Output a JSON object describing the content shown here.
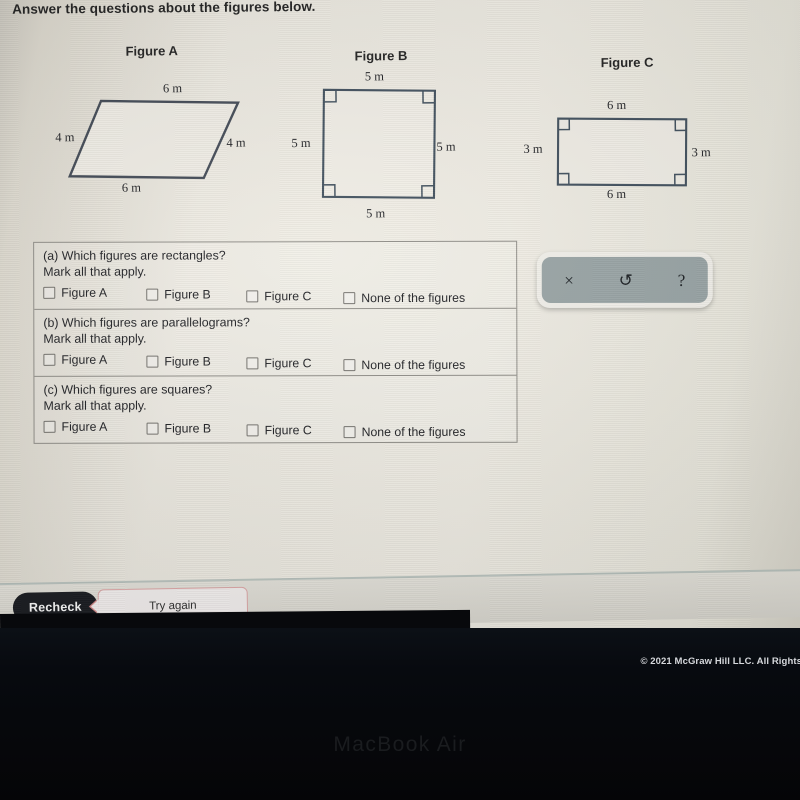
{
  "heading": "Answer the questions about the figures below.",
  "figures": [
    {
      "caption": "Figure A",
      "shape": "parallelogram",
      "labels": {
        "top": "6 m",
        "left": "4 m",
        "right": "4 m",
        "bottom": "6 m"
      }
    },
    {
      "caption": "Figure B",
      "shape": "square",
      "labels": {
        "top": "5 m",
        "left": "5 m",
        "right": "5 m",
        "bottom": "5 m"
      }
    },
    {
      "caption": "Figure C",
      "shape": "rectangle",
      "labels": {
        "top": "6 m",
        "left": "3 m",
        "right": "3 m",
        "bottom": "6 m"
      }
    }
  ],
  "questions": [
    {
      "prompt_line1": "(a) Which figures are rectangles?",
      "prompt_line2": "Mark all that apply.",
      "options": [
        "Figure A",
        "Figure B",
        "Figure C",
        "None of the figures"
      ]
    },
    {
      "prompt_line1": "(b) Which figures are parallelograms?",
      "prompt_line2": "Mark all that apply.",
      "options": [
        "Figure A",
        "Figure B",
        "Figure C",
        "None of the figures"
      ]
    },
    {
      "prompt_line1": "(c) Which figures are squares?",
      "prompt_line2": "Mark all that apply.",
      "options": [
        "Figure A",
        "Figure B",
        "Figure C",
        "None of the figures"
      ]
    }
  ],
  "toolbar": {
    "clear_label": "×",
    "undo_label": "↺",
    "help_label": "?",
    "background_color": "#97a3a4"
  },
  "footer": {
    "recheck_label": "Recheck",
    "try_again_label": "Try again",
    "copyright": "© 2021 McGraw Hill LLC. All Rights"
  },
  "device": {
    "brand_label": "MacBook Air"
  }
}
